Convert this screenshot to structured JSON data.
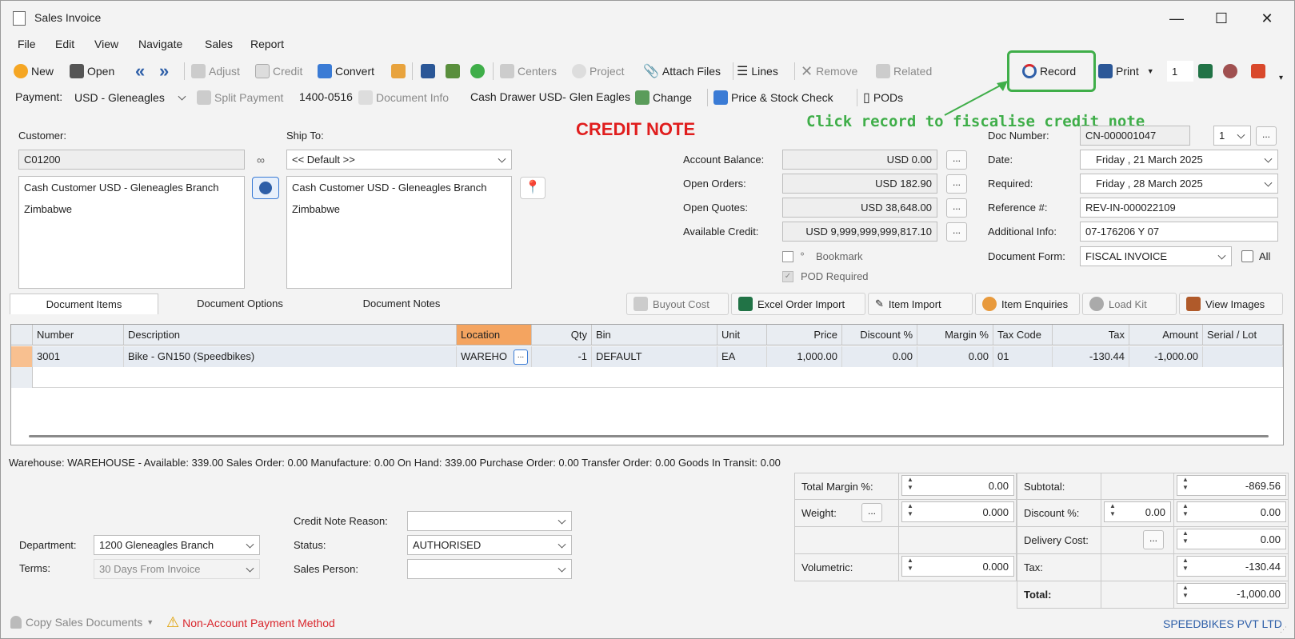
{
  "window": {
    "title": "Sales Invoice"
  },
  "menu": [
    "File",
    "Edit",
    "View",
    "Navigate",
    "Sales",
    "Report"
  ],
  "toolbar1": {
    "new": "New",
    "open": "Open",
    "adjust": "Adjust",
    "credit": "Credit",
    "convert": "Convert",
    "centers": "Centers",
    "project": "Project",
    "attach": "Attach Files",
    "lines": "Lines",
    "remove": "Remove",
    "related": "Related",
    "record": "Record",
    "print": "Print",
    "copies": "1"
  },
  "toolbar2": {
    "payment_label": "Payment:",
    "payment_value": "USD - Gleneagles",
    "split": "Split Payment",
    "code": "1400-0516",
    "docinfo": "Document Info",
    "drawer": "Cash Drawer USD- Glen Eagles",
    "change": "Change",
    "price": "Price & Stock Check",
    "pods": "PODs"
  },
  "annotation": "Click record to fiscalise credit note",
  "doc_type": "CREDIT NOTE",
  "customer": {
    "label": "Customer:",
    "code": "C01200",
    "name": "Cash Customer USD - Gleneagles Branch",
    "country": "Zimbabwe"
  },
  "shipto": {
    "label": "Ship To:",
    "value": "<< Default >>",
    "name": "Cash Customer USD - Gleneagles Branch",
    "country": "Zimbabwe"
  },
  "balances": {
    "account_balance_label": "Account Balance:",
    "account_balance": "USD 0.00",
    "open_orders_label": "Open Orders:",
    "open_orders": "USD 182.90",
    "open_quotes_label": "Open Quotes:",
    "open_quotes": "USD 38,648.00",
    "available_credit_label": "Available Credit:",
    "available_credit": "USD 9,999,999,999,817.10",
    "bookmark": "Bookmark",
    "pod_required": "POD Required"
  },
  "doc": {
    "number_label": "Doc Number:",
    "number": "CN-000001047",
    "copy": "1",
    "date_label": "Date:",
    "date": "Friday    , 21    March    2025",
    "required_label": "Required:",
    "required": "Friday    , 28    March    2025",
    "ref_label": "Reference #:",
    "ref": "REV-IN-000022109",
    "addl_label": "Additional Info:",
    "addl": "07-176206 Y 07",
    "form_label": "Document Form:",
    "form": "FISCAL INVOICE",
    "all": "All"
  },
  "tabs": [
    "Document Items",
    "Document Options",
    "Document Notes"
  ],
  "grid_buttons": [
    "Buyout Cost",
    "Excel Order Import",
    "Item Import",
    "Item Enquiries",
    "Load Kit",
    "View Images"
  ],
  "grid": {
    "headers": [
      "Number",
      "Description",
      "Location",
      "Qty",
      "Bin",
      "Unit",
      "Price",
      "Discount %",
      "Margin %",
      "Tax Code",
      "Tax",
      "Amount",
      "Serial / Lot"
    ],
    "rows": [
      [
        "3001",
        "Bike - GN150 (Speedbikes)",
        "WAREHO",
        "-1",
        "DEFAULT",
        "EA",
        "1,000.00",
        "0.00",
        "0.00",
        "01",
        "-130.44",
        "-1,000.00",
        ""
      ]
    ]
  },
  "status_line": "Warehouse: WAREHOUSE - Available: 339.00  Sales Order: 0.00  Manufacture: 0.00  On Hand: 339.00  Purchase Order: 0.00 Transfer Order: 0.00 Goods In Transit: 0.00",
  "footer_left": {
    "dept_label": "Department:",
    "dept": "1200 Gleneagles Branch",
    "terms_label": "Terms:",
    "terms": "30 Days From Invoice",
    "reason_label": "Credit Note Reason:",
    "reason": "",
    "status_label": "Status:",
    "status": "AUTHORISED",
    "sp_label": "Sales Person:",
    "sp": ""
  },
  "totals": {
    "margin_label": "Total Margin %:",
    "margin": "0.00",
    "weight_label": "Weight:",
    "weight": "0.000",
    "vol_label": "Volumetric:",
    "vol": "0.000",
    "subtotal_label": "Subtotal:",
    "subtotal": "-869.56",
    "disc_label": "Discount %:",
    "disc_pct": "0.00",
    "disc": "0.00",
    "delivery_label": "Delivery Cost:",
    "delivery": "0.00",
    "tax_label": "Tax:",
    "tax": "-130.44",
    "total_label": "Total:",
    "total": "-1,000.00"
  },
  "bottom": {
    "copy": "Copy Sales Documents",
    "warning": "Non-Account Payment Method",
    "company": "SPEEDBIKES PVT LTD"
  },
  "colors": {
    "accent_green": "#3fae49",
    "credit_red": "#e01e1e",
    "warning_red": "#d9262c"
  }
}
